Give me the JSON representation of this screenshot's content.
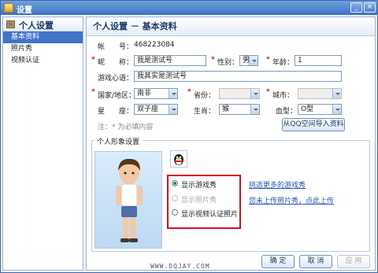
{
  "window": {
    "title": "设置"
  },
  "sidebar": {
    "header": "个人设置",
    "items": [
      {
        "label": "基本资料"
      },
      {
        "label": "照片秀"
      },
      {
        "label": "视频认证"
      }
    ]
  },
  "main": {
    "title": "个人设置 － 基本资料"
  },
  "form": {
    "account_label": "帐　　号：",
    "account_value": "468223084",
    "nickname_label": "昵　　称：",
    "nickname_value": "我是测试号",
    "gender_label": "性别：",
    "gender_value": "男",
    "age_label": "年龄：",
    "age_value": "1",
    "signature_label": "游戏心语：",
    "signature_value": "我其实是测试号",
    "country_label": "国家/地区：",
    "country_value": "南非",
    "province_label": "省份：",
    "province_value": "",
    "city_label": "城市：",
    "city_value": "",
    "star_label": "星　　座：",
    "star_value": "双子座",
    "zodiac_label": "生肖：",
    "zodiac_value": "猴",
    "blood_label": "血型：",
    "blood_value": "O型",
    "required_note": "注：* 为必填内容",
    "import_button": "从QQ空间导入资料"
  },
  "avatar_section": {
    "title": "个人形象设置",
    "options": [
      {
        "label": "显示游戏秀",
        "checked": true,
        "disabled": false
      },
      {
        "label": "显示照片秀",
        "checked": false,
        "disabled": true
      },
      {
        "label": "显示视频认证照片",
        "checked": false,
        "disabled": false
      }
    ],
    "link_more": "挑选更多的游戏秀",
    "link_upload": "您未上传照片秀，点此上传"
  },
  "footer": {
    "ok": "确 定",
    "cancel": "取 消",
    "apply": "应 用",
    "watermark": "WWW.DQJAY.COM"
  },
  "colors": {
    "title_bar": "#3b72c4",
    "selected": "#3f74c8",
    "required": "#d21a1a",
    "highlight_border": "#d5121b",
    "link": "#1f58c8"
  },
  "icons": [
    "settings-app-icon",
    "minimize-icon",
    "close-icon",
    "folder-icon",
    "dropdown-arrow-icon",
    "qq-penguin-icon"
  ]
}
